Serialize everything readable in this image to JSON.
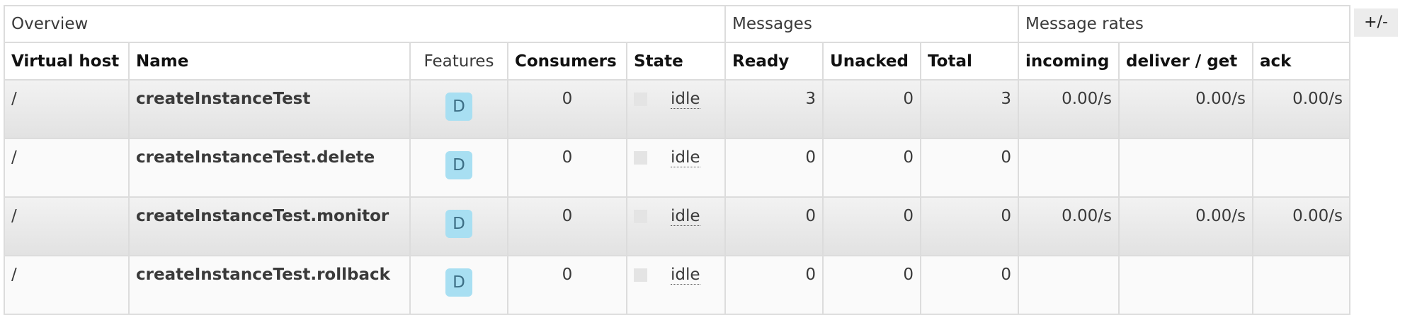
{
  "groups": {
    "overview": "Overview",
    "messages": "Messages",
    "message_rates": "Message rates"
  },
  "columns": {
    "virtual_host": "Virtual host",
    "name": "Name",
    "features": "Features",
    "consumers": "Consumers",
    "state": "State",
    "ready": "Ready",
    "unacked": "Unacked",
    "total": "Total",
    "incoming": "incoming",
    "deliver_get": "deliver / get",
    "ack": "ack"
  },
  "toggle_columns_label": "+/-",
  "rows": [
    {
      "vhost": "/",
      "name": "createInstanceTest",
      "feature": "D",
      "consumers": "0",
      "state": "idle",
      "ready": "3",
      "unacked": "0",
      "total": "3",
      "incoming": "0.00/s",
      "deliver_get": "0.00/s",
      "ack": "0.00/s"
    },
    {
      "vhost": "/",
      "name": "createInstanceTest.delete",
      "feature": "D",
      "consumers": "0",
      "state": "idle",
      "ready": "0",
      "unacked": "0",
      "total": "0",
      "incoming": "",
      "deliver_get": "",
      "ack": ""
    },
    {
      "vhost": "/",
      "name": "createInstanceTest.monitor",
      "feature": "D",
      "consumers": "0",
      "state": "idle",
      "ready": "0",
      "unacked": "0",
      "total": "0",
      "incoming": "0.00/s",
      "deliver_get": "0.00/s",
      "ack": "0.00/s"
    },
    {
      "vhost": "/",
      "name": "createInstanceTest.rollback",
      "feature": "D",
      "consumers": "0",
      "state": "idle",
      "ready": "0",
      "unacked": "0",
      "total": "0",
      "incoming": "",
      "deliver_get": "",
      "ack": ""
    }
  ]
}
